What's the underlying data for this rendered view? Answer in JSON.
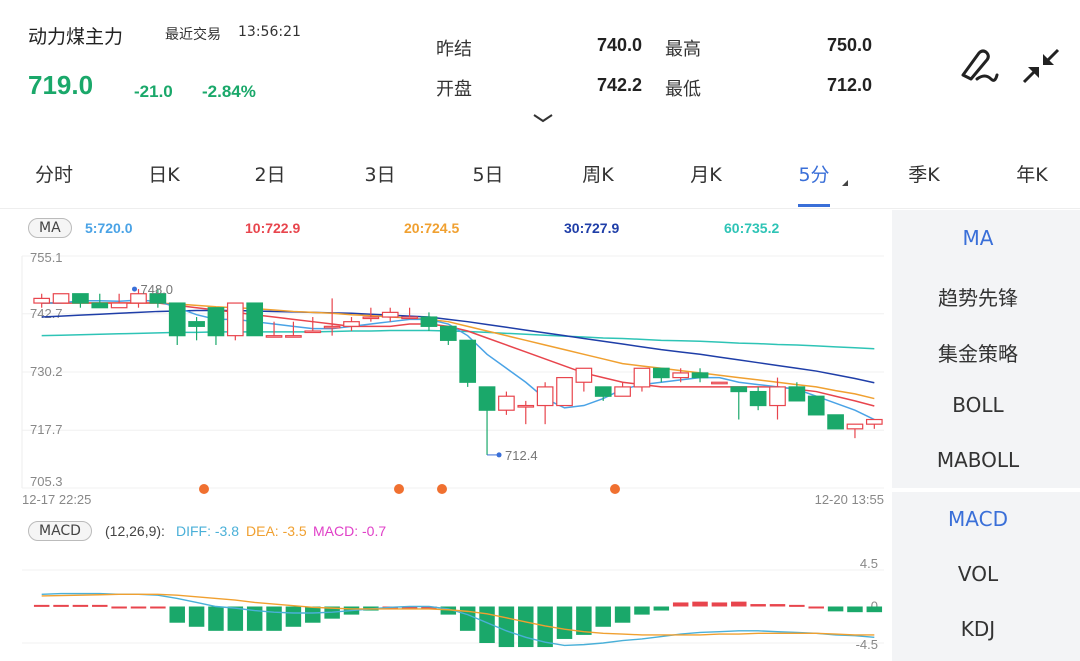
{
  "header": {
    "name": "动力煤主力",
    "last_trade_label": "最近交易",
    "last_trade_time": "13:56:21",
    "price": "719.0",
    "change": "-21.0",
    "change_pct": "-2.84%"
  },
  "quote": {
    "prev_settle_label": "昨结",
    "prev_settle": "740.0",
    "high_label": "最高",
    "high": "750.0",
    "open_label": "开盘",
    "open": "742.2",
    "low_label": "最低",
    "low": "712.0"
  },
  "tabs": [
    {
      "label": "分时"
    },
    {
      "label": "日K"
    },
    {
      "label": "2日"
    },
    {
      "label": "3日"
    },
    {
      "label": "5日"
    },
    {
      "label": "周K"
    },
    {
      "label": "月K"
    },
    {
      "label": "5分"
    },
    {
      "label": "季K"
    },
    {
      "label": "年K"
    }
  ],
  "active_tab": "5分",
  "side_main": [
    {
      "label": "MA"
    },
    {
      "label": "趋势先锋"
    },
    {
      "label": "集金策略"
    },
    {
      "label": "BOLL"
    },
    {
      "label": "MABOLL"
    }
  ],
  "side_sub": [
    {
      "label": "MACD"
    },
    {
      "label": "VOL"
    },
    {
      "label": "KDJ"
    }
  ],
  "ma": {
    "badge": "MA",
    "ma5": "5:720.0",
    "ma10": "10:722.9",
    "ma20": "20:724.5",
    "ma30": "30:727.9",
    "ma60": "60:735.2"
  },
  "macd": {
    "badge": "MACD",
    "params": "(12,26,9):",
    "diff": "DIFF: -3.8",
    "dea": "DEA: -3.5",
    "macd": "MACD: -0.7"
  },
  "colors": {
    "up": "#e8454d",
    "down": "#1aa86a",
    "ma5": "#4aa3e6",
    "ma10": "#e8454d",
    "ma20": "#f0a030",
    "ma30": "#1f3ea8",
    "ma60": "#2ec4b6",
    "diff": "#4ab0d8",
    "dea": "#f0a030",
    "macd": "#e040c8",
    "accent": "#3a6fd8"
  },
  "chart_data": {
    "type": "candlestick",
    "y_ticks": [
      "755.1",
      "742.7",
      "730.2",
      "717.7",
      "705.3"
    ],
    "ylim": [
      705.3,
      755.1
    ],
    "x_start": "12-17 22:25",
    "x_end": "12-20 13:55",
    "max_label": "748.0",
    "min_label": "712.4",
    "candles": [
      {
        "o": 745,
        "h": 747,
        "l": 744,
        "c": 746
      },
      {
        "o": 745,
        "h": 747,
        "l": 745,
        "c": 747
      },
      {
        "o": 747,
        "h": 747,
        "l": 744,
        "c": 745
      },
      {
        "o": 745,
        "h": 747,
        "l": 744,
        "c": 744
      },
      {
        "o": 744,
        "h": 747,
        "l": 744,
        "c": 745
      },
      {
        "o": 745,
        "h": 748,
        "l": 744,
        "c": 747
      },
      {
        "o": 747,
        "h": 748,
        "l": 744,
        "c": 745
      },
      {
        "o": 745,
        "h": 745,
        "l": 736,
        "c": 738
      },
      {
        "o": 741,
        "h": 742,
        "l": 737,
        "c": 740
      },
      {
        "o": 744,
        "h": 744,
        "l": 736,
        "c": 738
      },
      {
        "o": 738,
        "h": 745,
        "l": 737,
        "c": 745
      },
      {
        "o": 745,
        "h": 745,
        "l": 738,
        "c": 738
      },
      {
        "o": 738,
        "h": 741,
        "l": 738,
        "c": 738
      },
      {
        "o": 738,
        "h": 741,
        "l": 738,
        "c": 738
      },
      {
        "o": 739,
        "h": 742,
        "l": 739,
        "c": 739
      },
      {
        "o": 740,
        "h": 746,
        "l": 738,
        "c": 740
      },
      {
        "o": 740,
        "h": 742,
        "l": 739,
        "c": 741
      },
      {
        "o": 742,
        "h": 744,
        "l": 741,
        "c": 742
      },
      {
        "o": 742,
        "h": 744,
        "l": 741,
        "c": 743
      },
      {
        "o": 742,
        "h": 744,
        "l": 742,
        "c": 742
      },
      {
        "o": 742,
        "h": 743,
        "l": 739,
        "c": 740
      },
      {
        "o": 740,
        "h": 740,
        "l": 736,
        "c": 737
      },
      {
        "o": 737,
        "h": 737,
        "l": 727,
        "c": 728
      },
      {
        "o": 727,
        "h": 727,
        "l": 712.4,
        "c": 722
      },
      {
        "o": 722,
        "h": 726,
        "l": 721,
        "c": 725
      },
      {
        "o": 723,
        "h": 724,
        "l": 719,
        "c": 723
      },
      {
        "o": 723,
        "h": 728,
        "l": 719,
        "c": 727
      },
      {
        "o": 723,
        "h": 729,
        "l": 723,
        "c": 729
      },
      {
        "o": 728,
        "h": 731,
        "l": 726,
        "c": 731
      },
      {
        "o": 727,
        "h": 727,
        "l": 724,
        "c": 725
      },
      {
        "o": 725,
        "h": 728,
        "l": 725,
        "c": 727
      },
      {
        "o": 727,
        "h": 731,
        "l": 726,
        "c": 731
      },
      {
        "o": 731,
        "h": 731,
        "l": 728,
        "c": 729
      },
      {
        "o": 729,
        "h": 731,
        "l": 728,
        "c": 730
      },
      {
        "o": 730,
        "h": 731,
        "l": 728,
        "c": 729
      },
      {
        "o": 728,
        "h": 728,
        "l": 728,
        "c": 728
      },
      {
        "o": 727,
        "h": 727,
        "l": 720,
        "c": 726
      },
      {
        "o": 726,
        "h": 727,
        "l": 722,
        "c": 723
      },
      {
        "o": 723,
        "h": 729,
        "l": 720,
        "c": 727
      },
      {
        "o": 727,
        "h": 728,
        "l": 724,
        "c": 724
      },
      {
        "o": 725,
        "h": 725,
        "l": 721,
        "c": 721
      },
      {
        "o": 721,
        "h": 721,
        "l": 718,
        "c": 718
      },
      {
        "o": 718,
        "h": 719,
        "l": 716,
        "c": 719
      },
      {
        "o": 719,
        "h": 720,
        "l": 718,
        "c": 720
      }
    ],
    "ma5": [
      745,
      745,
      745.5,
      745.5,
      745.4,
      745.6,
      745.4,
      744,
      742.5,
      741.5,
      741.5,
      741,
      740.5,
      740,
      739.5,
      739.5,
      740,
      740.5,
      741,
      741.5,
      741.5,
      740.5,
      738,
      734,
      731,
      728,
      724.5,
      722.5,
      723,
      724.5,
      726.5,
      727.5,
      728,
      728.5,
      729,
      729,
      728,
      727.5,
      727,
      726.5,
      725,
      723.5,
      722,
      720
    ],
    "ma10": [
      745,
      745,
      745,
      745,
      745,
      745,
      745,
      744.5,
      744,
      743.5,
      743,
      742.5,
      742,
      741.5,
      741,
      740.5,
      740,
      740,
      740,
      740.5,
      740.5,
      740,
      739,
      737.5,
      736,
      734.5,
      733,
      731.5,
      730,
      729,
      728,
      727.5,
      727,
      727,
      727,
      727,
      727,
      727,
      727,
      726.5,
      726,
      725,
      724,
      722.9
    ],
    "ma20": [
      745,
      745,
      745,
      745,
      745,
      745,
      745,
      744.8,
      744.5,
      744.2,
      744,
      743.8,
      743.5,
      743.2,
      743,
      742.8,
      742.5,
      742.3,
      742,
      741.8,
      741.5,
      741,
      740,
      739,
      738,
      737,
      736,
      735,
      734,
      733,
      732,
      731.5,
      731,
      730.5,
      730,
      729.5,
      729,
      728.5,
      728,
      727.5,
      727,
      726.2,
      725.5,
      724.5
    ],
    "ma30": [
      742,
      742.2,
      742.4,
      742.6,
      742.8,
      743,
      743.2,
      743.3,
      743.4,
      743.4,
      743.4,
      743.3,
      743.2,
      743.1,
      743,
      742.9,
      742.8,
      742.6,
      742.4,
      742.2,
      742,
      741.5,
      741,
      740.4,
      739.8,
      739.2,
      738.6,
      738,
      737.4,
      736.8,
      736.2,
      735.6,
      735,
      734.5,
      734,
      733.4,
      732.8,
      732.2,
      731.6,
      731,
      730.4,
      729.6,
      728.8,
      727.9
    ],
    "ma60": [
      738,
      738.1,
      738.2,
      738.3,
      738.4,
      738.5,
      738.6,
      738.7,
      738.7,
      738.8,
      738.8,
      738.8,
      738.8,
      738.8,
      738.8,
      738.9,
      739,
      739,
      739.1,
      739.1,
      739.1,
      739,
      738.9,
      738.7,
      738.5,
      738.3,
      738.1,
      737.9,
      737.7,
      737.5,
      737.4,
      737.2,
      737,
      736.9,
      736.8,
      736.6,
      736.4,
      736.3,
      736.1,
      736,
      735.8,
      735.6,
      735.4,
      735.2
    ],
    "macd_ticks": [
      "4.5",
      "0",
      "-4.5"
    ],
    "macd_ylim": [
      -4.5,
      4.5
    ],
    "diff": [
      1.5,
      1.6,
      1.6,
      1.6,
      1.5,
      1.5,
      1.4,
      1,
      0.5,
      0,
      -0.2,
      -0.5,
      -0.7,
      -0.8,
      -0.8,
      -0.7,
      -0.5,
      -0.3,
      -0.1,
      0,
      0,
      -0.3,
      -1,
      -2,
      -3,
      -3.8,
      -4.4,
      -4.8,
      -4.7,
      -4.5,
      -4.2,
      -4,
      -3.7,
      -3.4,
      -3.2,
      -3.1,
      -3,
      -3,
      -3.1,
      -3.2,
      -3.3,
      -3.5,
      -3.6,
      -3.8
    ],
    "dea": [
      1.3,
      1.35,
      1.4,
      1.45,
      1.5,
      1.5,
      1.5,
      1.4,
      1.2,
      1,
      0.8,
      0.5,
      0.3,
      0.1,
      -0.1,
      -0.2,
      -0.3,
      -0.3,
      -0.3,
      -0.3,
      -0.3,
      -0.4,
      -0.6,
      -0.9,
      -1.4,
      -1.9,
      -2.4,
      -2.8,
      -3.1,
      -3.3,
      -3.4,
      -3.5,
      -3.5,
      -3.5,
      -3.5,
      -3.4,
      -3.4,
      -3.3,
      -3.3,
      -3.3,
      -3.3,
      -3.4,
      -3.5,
      -3.5
    ],
    "macd": [
      0.2,
      0.2,
      0.2,
      0.2,
      0,
      0,
      0,
      -2,
      -2.5,
      -3,
      -3,
      -3,
      -3,
      -2.5,
      -2,
      -1.5,
      -1,
      -0.5,
      0,
      0,
      0,
      -1,
      -3,
      -4.5,
      -5,
      -5,
      -5,
      -4,
      -3.5,
      -2.5,
      -2,
      -1,
      -0.5,
      0.5,
      0.6,
      0.5,
      0.6,
      0.3,
      0.3,
      0.2,
      0,
      -0.6,
      -0.7,
      -0.7
    ]
  }
}
